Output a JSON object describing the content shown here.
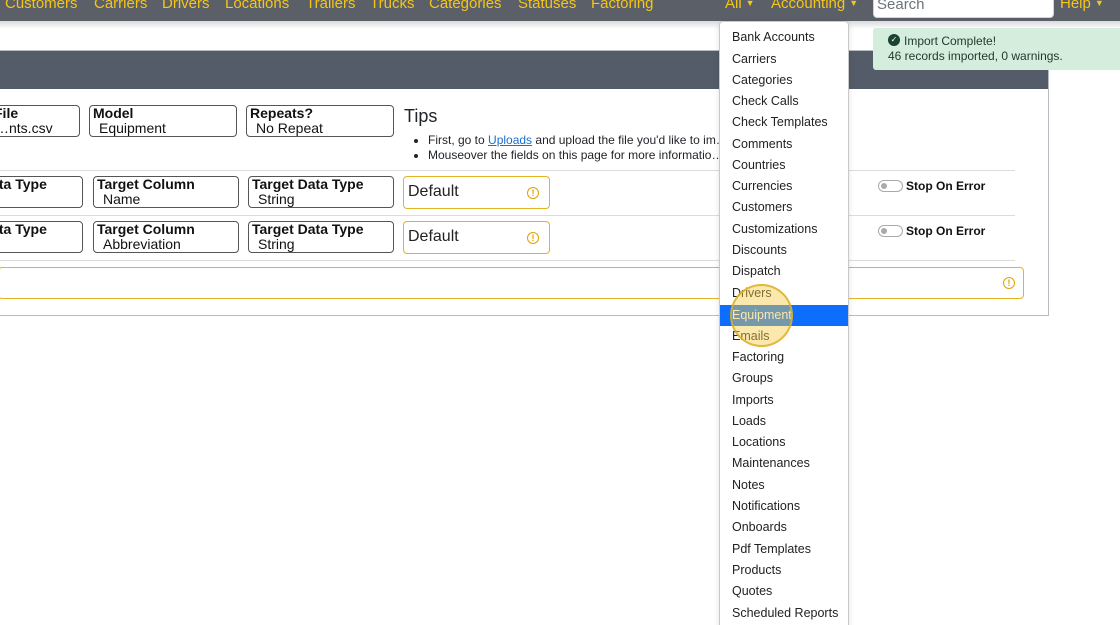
{
  "nav": {
    "links": [
      "Customers",
      "Carriers",
      "Drivers",
      "Locations",
      "Trailers",
      "Trucks",
      "Categories",
      "Statuses",
      "Factoring"
    ],
    "all_label": "All",
    "accounting_label": "Accounting",
    "search_placeholder": "Search",
    "help_label": "Help",
    "link_color": "#f5c518"
  },
  "import_form": {
    "file": {
      "label": "File",
      "value": "…nts.csv"
    },
    "model": {
      "label": "Model",
      "value": "Equipment"
    },
    "repeats": {
      "label": "Repeats?",
      "value": "No Repeat"
    },
    "tips": {
      "title": "Tips",
      "tip1_prefix": "First, go to",
      "tip1_link": "Uploads",
      "tip1_suffix": "and upload the file you'd like to im…",
      "tip2": "Mouseover the fields on this page for more informatio…"
    },
    "rows": [
      {
        "data_type_label": "Data Type",
        "target_column_label": "Target Column",
        "target_column_value": "Name",
        "target_data_type_label": "Target Data Type",
        "target_data_type_value": "String",
        "default_placeholder": "Default",
        "stop_on_error_label": "Stop On Error"
      },
      {
        "data_type_label": "Data Type",
        "target_column_label": "Target Column",
        "target_column_value": "Abbreviation",
        "target_data_type_label": "Target Data Type",
        "target_data_type_value": "String",
        "default_placeholder": "Default",
        "stop_on_error_label": "Stop On Error"
      }
    ]
  },
  "toast": {
    "title": "Import Complete!",
    "message": "46 records imported, 0 warnings.",
    "icon": "check-circle-icon"
  },
  "dropdown": {
    "items": [
      "Bank Accounts",
      "Carriers",
      "Categories",
      "Check Calls",
      "Check Templates",
      "Comments",
      "Countries",
      "Currencies",
      "Customers",
      "Customizations",
      "Discounts",
      "Dispatch",
      "Drivers",
      "Equipment",
      "Emails",
      "Factoring",
      "Groups",
      "Imports",
      "Loads",
      "Locations",
      "Maintenances",
      "Notes",
      "Notifications",
      "Onboards",
      "Pdf Templates",
      "Products",
      "Quotes",
      "Scheduled Reports"
    ],
    "active_item": "Equipment",
    "active_color": "#0d6efd"
  }
}
